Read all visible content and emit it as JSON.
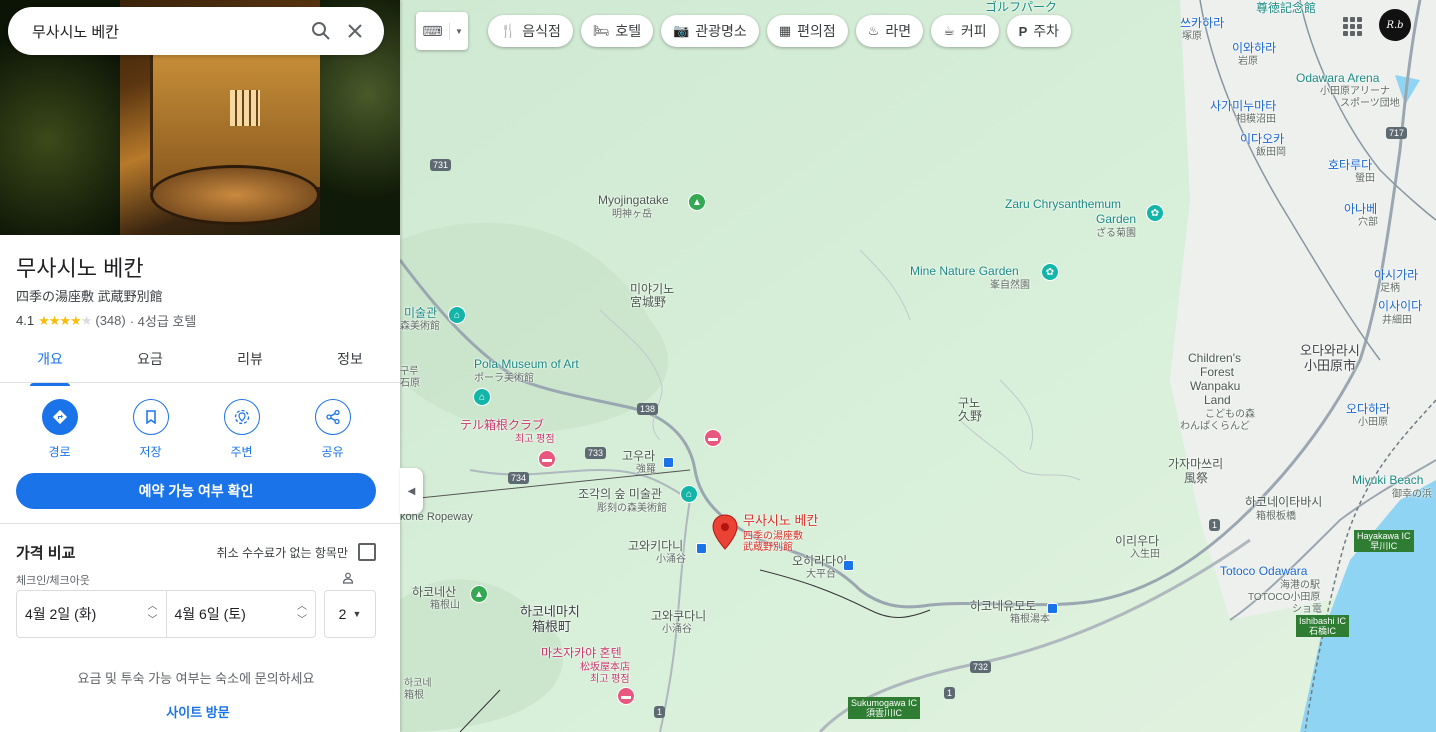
{
  "search": {
    "query": "무사시노 베칸"
  },
  "place": {
    "name": "무사시노 베칸",
    "subtitle": "四季の湯座敷 武蔵野別館",
    "rating": "4.1",
    "stars": "★★★★",
    "stars_off": "★",
    "reviews": "(348)",
    "category": "· 4성급 호텔"
  },
  "tabs": [
    {
      "label": "개요"
    },
    {
      "label": "요금"
    },
    {
      "label": "리뷰"
    },
    {
      "label": "정보"
    }
  ],
  "actions": [
    {
      "label": "경로",
      "icon": "directions-icon"
    },
    {
      "label": "저장",
      "icon": "bookmark-icon"
    },
    {
      "label": "주변",
      "icon": "nearby-icon"
    },
    {
      "label": "공유",
      "icon": "share-icon"
    }
  ],
  "book_button": "예약 가능 여부 확인",
  "price_compare": {
    "title": "가격 비교",
    "free_cancel": "취소 수수료가 없는 항목만",
    "checkin_label": "체크인/체크아웃",
    "checkin": "4월 2일 (화)",
    "checkout": "4월 6일 (토)",
    "guests": "2",
    "inquire": "요금 및 투숙 가능 여부는 숙소에 문의하세요",
    "visit_site": "사이트 방문"
  },
  "chips": [
    {
      "label": "음식점",
      "icon": "restaurant-icon"
    },
    {
      "label": "호텔",
      "icon": "hotel-icon"
    },
    {
      "label": "관광명소",
      "icon": "camera-icon"
    },
    {
      "label": "편의점",
      "icon": "store-icon"
    },
    {
      "label": "라면",
      "icon": "ramen-icon"
    },
    {
      "label": "커피",
      "icon": "coffee-icon"
    },
    {
      "label": "주차",
      "icon": "parking-icon"
    }
  ],
  "avatar": "R.b",
  "map": {
    "labels": {
      "myojingatake": "Myojingatake",
      "myojingatake_jp": "明神ヶ岳",
      "miyagino": "미야기노",
      "miyagino_jp": "宮城野",
      "zaru": "Zaru Chrysanthemum",
      "zaru2": "Garden",
      "zaru_jp": "ざる菊園",
      "mine": "Mine Nature Garden",
      "mine_jp": "峯自然園",
      "pola": "Pola Museum of Art",
      "pola_jp": "ポーラ美術館",
      "museum": "미술관",
      "museum_jp": "森美術館",
      "club": "テル箱根クラブ",
      "club_sub": "최고 평점",
      "gora": "고우라",
      "gora_jp": "強羅",
      "sculpture": "조각의 숲 미술관",
      "sculpture_jp": "彫刻の森美術館",
      "kowakidani": "고와키다니",
      "kowakidani_jp": "小涌谷",
      "ohiradai": "오히라다이",
      "ohiradai_jp": "大平台",
      "hakoneyama": "하코네산",
      "hakoneyama_jp": "箱根山",
      "hakone_town": "하코네마치",
      "hakone_town_jp": "箱根町",
      "kowakudani": "고와쿠다니",
      "kowakudani_jp": "小涌谷",
      "matsuzakaya": "마츠자카야 혼텐",
      "matsuzakaya_jp": "松坂屋本店",
      "matsuzakaya_sub": "최고 평점",
      "ropeway": "kone Ropeway",
      "kuno": "구노",
      "kuno_jp": "久野",
      "kazamatsuri": "가자마쓰리",
      "kazamatsuri_jp": "風祭",
      "iriuda": "이리우다",
      "iriuda_jp": "入生田",
      "yumoto": "하코네유모토",
      "yumoto_jp": "箱根湯本",
      "itabashi": "하코네이타바시",
      "itabashi_jp": "箱根板橋",
      "childrens": "Children's",
      "childrens2": "Forest",
      "childrens3": "Wanpaku",
      "childrens4": "Land",
      "childrens_jp": "こどもの森",
      "childrens_jp2": "わんぱくらんど",
      "odawara_city": "오다와라시",
      "odawara_city_jp": "小田原市",
      "odawara_st": "오다하라",
      "odawara_st_jp": "小田原",
      "arena": "Odawara Arena",
      "arena_jp": "小田原アリーナ",
      "arena_jp2": "スポーツ団地",
      "miyuki": "Miyuki Beach",
      "miyuki_jp": "御幸の浜",
      "totoco": "Totoco Odawara",
      "totoco_jp": "海港の駅",
      "totoco_jp2": "TOTOCO小田原",
      "totoco_jp3": "ショ電",
      "sagami": "사가미누마타",
      "sagami_jp": "相模沼田",
      "idaoka": "이다오카",
      "idaoka_jp": "飯田岡",
      "hotaruda": "호타루다",
      "hotaruda_jp": "螢田",
      "anabe": "아나베",
      "anabe_jp": "穴部",
      "ashigara": "아시가라",
      "ashigara_jp": "足柄",
      "isaida": "이사이다",
      "isaida_jp": "井細田",
      "iwahara": "이와하라",
      "iwahara_jp": "岩原",
      "zukahara": "쓰카하라",
      "zukahara_jp": "塚原",
      "nitoku": "尊徳記念館",
      "golf": "ゴルフパーク",
      "kuru": "구루",
      "kuru_jp": "石原",
      "hakone_bot": "하코네",
      "hakone_bot_jp": "箱根",
      "pin_name": "무사시노 베칸",
      "pin_jp": "四季の湯座敷",
      "pin_jp2": "武蔵野別館"
    },
    "roads": [
      "731",
      "138",
      "733",
      "734",
      "1",
      "732",
      "717",
      "1",
      "1"
    ],
    "ics": [
      "Hayakawa IC",
      "早川IC",
      "Ishibashi IC",
      "石橋IC",
      "Sukumogawa IC",
      "須雲川IC"
    ]
  }
}
